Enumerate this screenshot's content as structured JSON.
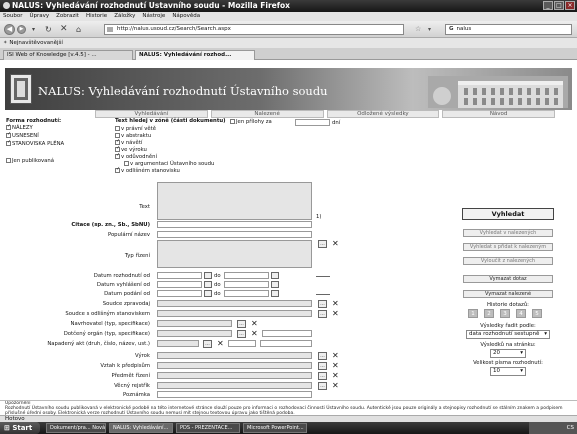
{
  "window": {
    "title": "NALUS: Vyhledávání rozhodnutí Ustavního soudu - Mozilla Firefox"
  },
  "menu": [
    "Soubor",
    "Úpravy",
    "Zobrazit",
    "Historie",
    "Záložky",
    "Nástroje",
    "Nápověda"
  ],
  "navbar": {
    "url": "http://nalus.usoud.cz/Search/Search.aspx",
    "search_value": "nalus",
    "search_engine_label": "G"
  },
  "bookmarks": {
    "label": "Nejnavštěvovanější"
  },
  "tabs": [
    {
      "label": "ISI Web of Knowledge [v.4.5] - ..."
    },
    {
      "label": "NALUS: Vyhledávání rozhod..."
    }
  ],
  "site": {
    "title": "NALUS: Vyhledávání rozhodnutí Ústavního soudu"
  },
  "site_tabs": [
    "Vyhledávání",
    "Nalezené",
    "Odložené výsledky",
    "Návod"
  ],
  "form": {
    "forma_heading": "Forma rozhodnutí:",
    "forma_options": [
      {
        "label": "NÁLEZY",
        "checked": true
      },
      {
        "label": "USNESENÍ",
        "checked": true
      },
      {
        "label": "STANOVISKA PLÉNA",
        "checked": true
      }
    ],
    "published_label": "Jen publikovaná",
    "text_heading": "Text hledej v zóně (části dokumentu)",
    "zones": [
      {
        "label": "v právní větě",
        "checked": false
      },
      {
        "label": "v abstraktu",
        "checked": false
      },
      {
        "label": "v návětí",
        "checked": true
      },
      {
        "label": "ve výroku",
        "checked": true
      },
      {
        "label": "v odůvodnění",
        "checked": true
      },
      {
        "label": "v argumentaci Ústavního soudu",
        "checked": false
      },
      {
        "label": "v odlišném stanovisku",
        "checked": true
      }
    ],
    "attachments_label": "Jen přílohy za",
    "attachments_suffix": "dní",
    "text_label": "Text",
    "text_note": "1)",
    "citace_label": "Citace (sp. zn., Sb., SbNU)",
    "popularni_label": "Populární název",
    "typ_label": "Typ řízení",
    "date_rows": [
      "Datum rozhodnutí od",
      "Datum vyhlášení od",
      "Datum podání od"
    ],
    "date_do": "do",
    "soudce_label": "Soudce zpravodaj",
    "soudce_odlisne_label": "Soudce s odlišným stanoviskem",
    "navrhovatel_label": "Navrhovatel (typ, specifikace)",
    "dotceny_label": "Dotčený orgán (typ, specifikace)",
    "napadeny_label": "Napadený akt (druh, číslo, název, ust.)",
    "vyrok_label": "Výrok",
    "vztah_label": "Vztah k předpisům",
    "predmet_label": "Předmět řízení",
    "vecny_label": "Věcný rejstřík",
    "poznamka_label": "Poznámka",
    "dots_label": "...",
    "x_label": "✕"
  },
  "right_panel": {
    "search_button": "Vyhledat",
    "nalezene_buttons": [
      "Vyhledat v nalezených",
      "Vyhledat s přidat k nalezeným",
      "Vyloučit z nalezených"
    ],
    "clear_button": "Vymazat dotaz",
    "clear_found_button": "Vymazat nalezené",
    "history_label": "Historie dotazů:",
    "history_pages": [
      "1",
      "2",
      "3",
      "4",
      "5"
    ],
    "sort_label": "Výsledky řadit podle:",
    "sort_value": "data rozhodnutí sestupně",
    "per_page_label": "Výsledků na stránku:",
    "per_page_value": "20",
    "font_label": "Velikost písma rozhodnutí:",
    "font_value": "10"
  },
  "footer": {
    "heading": "Upozornění",
    "text": "Rozhodnutí Ústavního soudu publikovaná v elektronické podobě na této internetové stránce slouží pouze pro informaci o rozhodovací činnosti Ústavního soudu. Autentické jsou pouze originály a stejnopisy rozhodnutí se stálním znakem a podpisem příslušné úřední osoby. Elektronická verze rozhodnutí Ústavního soudu nemusí mít stejnou textovou úpravu jako tištěná podoba."
  },
  "status": "Hotovo",
  "taskbar": {
    "start": "Start",
    "tasks": [
      "Dokument/pra... Nová...",
      "NALUS: Vyhledávání...",
      "PDS - PREZENTACE...",
      "Microsoft PowerPoint..."
    ],
    "clock": "CS"
  }
}
